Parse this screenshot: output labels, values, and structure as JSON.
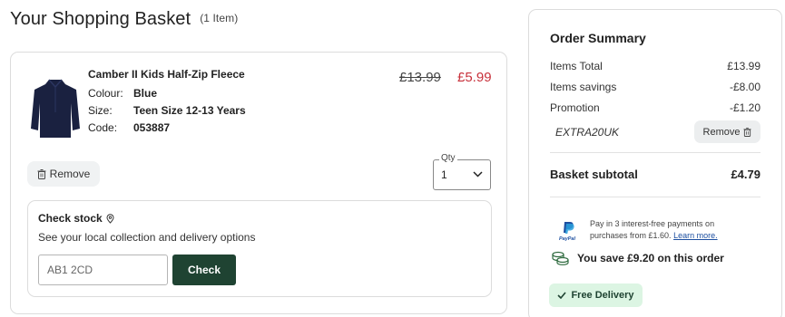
{
  "basket": {
    "title": "Your Shopping Basket",
    "count_label": "(1 Item)"
  },
  "item": {
    "name": "Camber II Kids Half-Zip Fleece",
    "colour_label": "Colour:",
    "colour_value": "Blue",
    "size_label": "Size:",
    "size_value": "Teen Size 12-13 Years",
    "code_label": "Code:",
    "code_value": "053887",
    "price_old": "£13.99",
    "price_new": "£5.99",
    "remove_label": "Remove",
    "qty_label": "Qty",
    "qty_value": "1",
    "image_icon": "navy-fleece-jacket-image"
  },
  "stock": {
    "title": "Check stock",
    "subtitle": "See your local collection and delivery options",
    "postcode_placeholder": "AB1 2CD",
    "check_label": "Check"
  },
  "summary": {
    "title": "Order Summary",
    "items_total_label": "Items Total",
    "items_total_value": "£13.99",
    "savings_label": "Items savings",
    "savings_value": "-£8.00",
    "promotion_label": "Promotion",
    "promotion_value": "-£1.20",
    "promo_code": "EXTRA20UK",
    "promo_remove_label": "Remove",
    "subtotal_label": "Basket subtotal",
    "subtotal_value": "£4.79",
    "paypal_text": "Pay in 3 interest-free payments on purchases from £1.60.",
    "paypal_link": "Learn more.",
    "savings_note": "You save £9.20 on this order",
    "free_delivery": "Free Delivery"
  },
  "colors": {
    "brand_dark_green": "#1f4332",
    "sale_red": "#c8323c",
    "free_delivery_bg": "#dcf5e3"
  }
}
